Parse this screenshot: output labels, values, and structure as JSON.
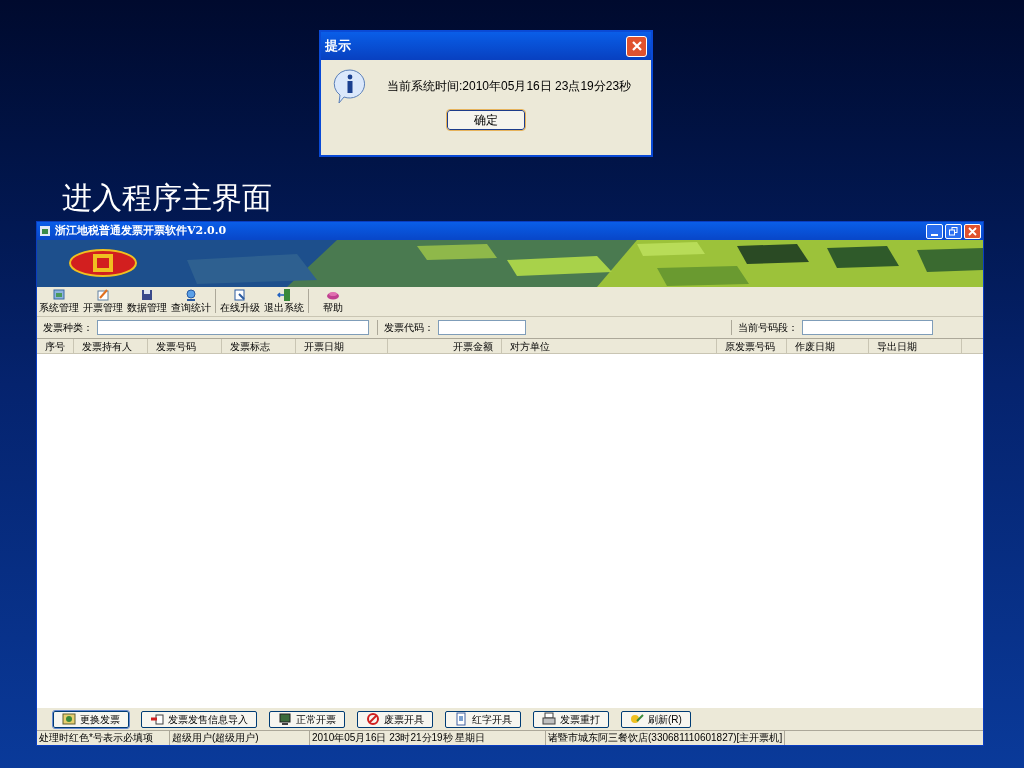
{
  "dialog": {
    "title": "提示",
    "message": "当前系统时间:2010年05月16日 23点19分23秒",
    "ok_button": "确定"
  },
  "heading": "进入程序主界面",
  "window": {
    "title": "浙江地税普通发票开票软件V2.0.0"
  },
  "toolbar_groups": [
    [
      "系统管理",
      "开票管理",
      "数据管理",
      "查询统计"
    ],
    [
      "在线升级",
      "退出系统"
    ],
    [
      "帮助"
    ]
  ],
  "filters": [
    {
      "label": "发票种类："
    },
    {
      "label": "发票代码："
    },
    {
      "label": "当前号码段："
    }
  ],
  "table": {
    "columns": [
      "序号",
      "发票持有人",
      "发票号码",
      "发票标志",
      "开票日期",
      "开票金额",
      "对方单位",
      "原发票号码",
      "作废日期",
      "导出日期"
    ]
  },
  "bottom_buttons": [
    "更换发票",
    "发票发售信息导入",
    "正常开票",
    "废票开具",
    "红字开具",
    "发票重打",
    "刷新(R)"
  ],
  "status_bar": [
    "处理时红色*号表示必填项",
    "超级用户(超级用户)",
    "2010年05月16日 23时21分19秒 星期日",
    "诸暨市城东阿三餐饮店(330681110601827)[主开票机]"
  ]
}
